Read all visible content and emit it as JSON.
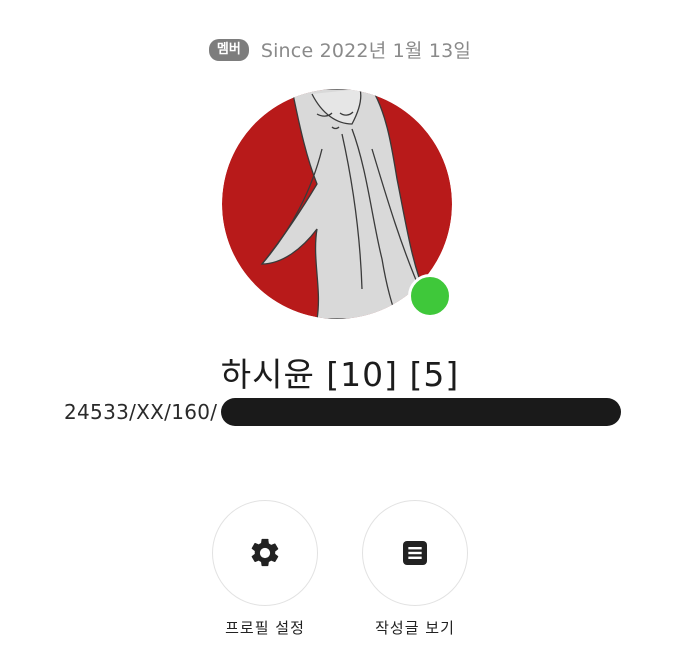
{
  "profile": {
    "role_badge": "멤버",
    "since_text": "Since 2022년 1월 13일",
    "display_name": "하시윤 [10] [5]",
    "sub_info": "24533/XX/160/",
    "status": "online"
  },
  "actions": [
    {
      "label": "프로필 설정",
      "icon": "gear-icon"
    },
    {
      "label": "작성글 보기",
      "icon": "document-icon"
    }
  ],
  "colors": {
    "avatar_bg": "#b81a1a",
    "status_online": "#3fc83a",
    "badge_bg": "#7d7d7d",
    "redaction": "#1a1a1a"
  }
}
